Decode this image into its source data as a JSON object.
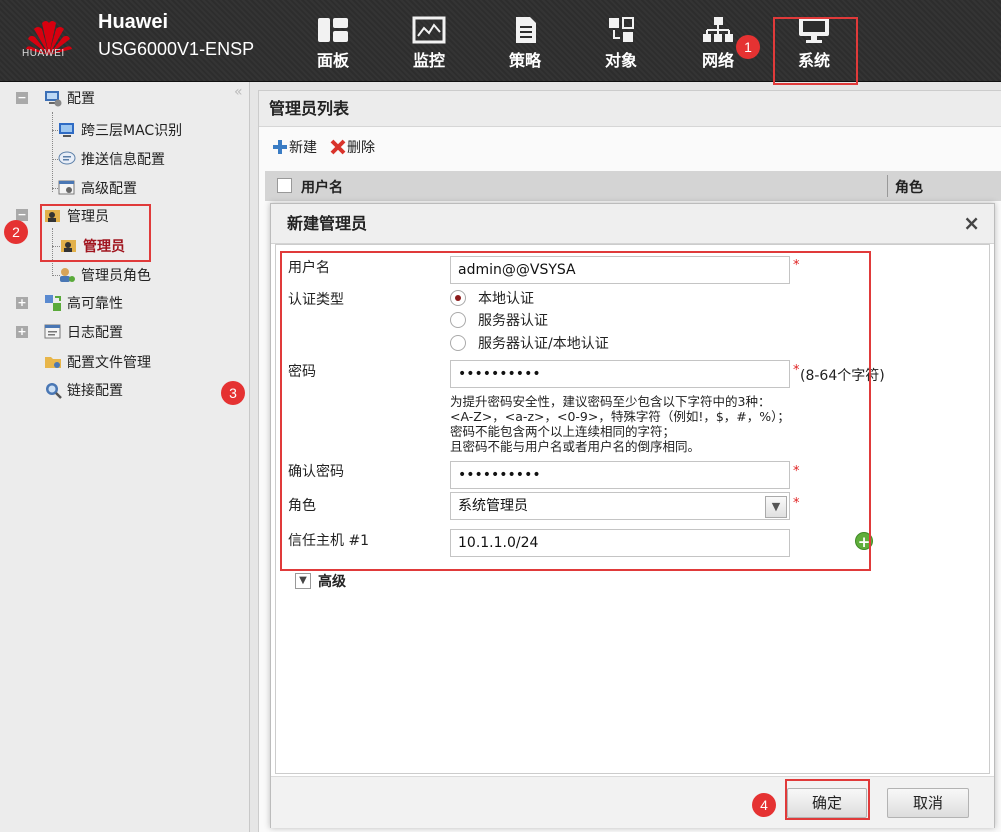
{
  "header": {
    "brand_name": "Huawei",
    "model": "USG6000V1-ENSP",
    "logo_text": "HUAWEI",
    "nav": [
      {
        "label": "面板",
        "icon": "dashboard-icon"
      },
      {
        "label": "监控",
        "icon": "monitor-chart-icon"
      },
      {
        "label": "策略",
        "icon": "policy-document-icon"
      },
      {
        "label": "对象",
        "icon": "object-icon"
      },
      {
        "label": "网络",
        "icon": "network-topology-icon"
      },
      {
        "label": "系统",
        "icon": "system-monitor-icon"
      }
    ]
  },
  "badges": {
    "b1": "1",
    "b2": "2",
    "b3": "3",
    "b4": "4"
  },
  "sidebar": {
    "collapse_glyph": "«",
    "items": [
      {
        "label": "配置"
      },
      {
        "label": "跨三层MAC识别"
      },
      {
        "label": "推送信息配置"
      },
      {
        "label": "高级配置"
      },
      {
        "label": "管理员"
      },
      {
        "label": "管理员"
      },
      {
        "label": "管理员角色"
      },
      {
        "label": "高可靠性"
      },
      {
        "label": "日志配置"
      },
      {
        "label": "配置文件管理"
      },
      {
        "label": "链接配置"
      }
    ]
  },
  "panel": {
    "title": "管理员列表",
    "toolbar": {
      "new_label": "新建",
      "delete_label": "删除"
    },
    "columns": [
      "用户名",
      "角色"
    ]
  },
  "dialog": {
    "title": "新建管理员",
    "close_glyph": "×",
    "username": {
      "label": "用户名",
      "value": "admin@@VSYSA"
    },
    "auth": {
      "label": "认证类型",
      "options": [
        "本地认证",
        "服务器认证",
        "服务器认证/本地认证"
      ],
      "selected": "本地认证"
    },
    "password": {
      "label": "密码",
      "value": "••••••••••",
      "length_hint": "(8-64个字符)",
      "hint_lines": [
        "为提升密码安全性，建议密码至少包含以下字符中的3种：",
        "<A-Z>，<a-z>，<0-9>，特殊字符（例如!，$，#，%）；",
        "密码不能包含两个以上连续相同的字符；",
        "且密码不能与用户名或者用户名的倒序相同。"
      ]
    },
    "confirm_password": {
      "label": "确认密码",
      "value": "••••••••••"
    },
    "role": {
      "label": "角色",
      "value": "系统管理员"
    },
    "trusted_host": {
      "label": "信任主机 #1",
      "value": "10.1.1.0/24"
    },
    "advanced_label": "高级",
    "required_mark": "*",
    "ok_label": "确定",
    "cancel_label": "取消"
  },
  "colors": {
    "highlight": "#e03a3a",
    "active_text": "#a0141e",
    "brand_red": "#d7000f"
  }
}
